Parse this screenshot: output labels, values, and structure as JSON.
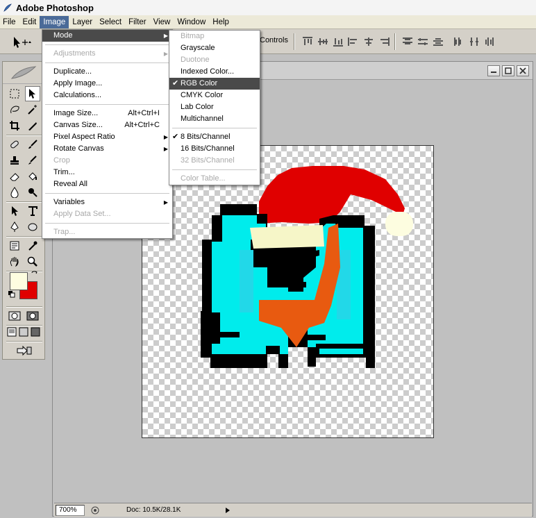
{
  "window": {
    "title": "Adobe Photoshop"
  },
  "menubar": [
    "File",
    "Edit",
    "Image",
    "Layer",
    "Select",
    "Filter",
    "View",
    "Window",
    "Help"
  ],
  "options_bar": {
    "controls_label": "Controls"
  },
  "image_menu": [
    {
      "label": "Mode",
      "submenu": true,
      "highlighted": true
    },
    {
      "sep": true
    },
    {
      "label": "Adjustments",
      "submenu": true,
      "disabled": true
    },
    {
      "sep": true
    },
    {
      "label": "Duplicate..."
    },
    {
      "label": "Apply Image..."
    },
    {
      "label": "Calculations..."
    },
    {
      "sep": true
    },
    {
      "label": "Image Size...",
      "shortcut": "Alt+Ctrl+I"
    },
    {
      "label": "Canvas Size...",
      "shortcut": "Alt+Ctrl+C"
    },
    {
      "label": "Pixel Aspect Ratio",
      "submenu": true
    },
    {
      "label": "Rotate Canvas",
      "submenu": true
    },
    {
      "label": "Crop",
      "disabled": true
    },
    {
      "label": "Trim..."
    },
    {
      "label": "Reveal All"
    },
    {
      "sep": true
    },
    {
      "label": "Variables",
      "submenu": true
    },
    {
      "label": "Apply Data Set...",
      "disabled": true
    },
    {
      "sep": true
    },
    {
      "label": "Trap...",
      "disabled": true
    }
  ],
  "mode_menu": [
    {
      "label": "Bitmap",
      "disabled": true
    },
    {
      "label": "Grayscale"
    },
    {
      "label": "Duotone",
      "disabled": true
    },
    {
      "label": "Indexed Color..."
    },
    {
      "label": "RGB Color",
      "checked": true,
      "highlighted": true
    },
    {
      "label": "CMYK Color"
    },
    {
      "label": "Lab Color"
    },
    {
      "label": "Multichannel"
    },
    {
      "sep": true
    },
    {
      "label": "8 Bits/Channel",
      "checked": true
    },
    {
      "label": "16 Bits/Channel"
    },
    {
      "label": "32 Bits/Channel",
      "disabled": true
    },
    {
      "sep": true
    },
    {
      "label": "Color Table...",
      "disabled": true
    }
  ],
  "status": {
    "zoom": "700%",
    "doc": "Doc: 10.5K/28.1K"
  },
  "colors": {
    "foreground": "#fdfde0",
    "background": "#e00000",
    "menu_highlight": "#4a4a4a"
  },
  "icons": [
    "photoshop-app-icon",
    "move-tool-icon",
    "marquee-tool-icon",
    "lasso-tool-icon",
    "magic-wand-icon",
    "crop-tool-icon",
    "slice-tool-icon",
    "healing-brush-icon",
    "brush-tool-icon",
    "clone-stamp-icon",
    "history-brush-icon",
    "eraser-tool-icon",
    "paint-bucket-icon",
    "blur-tool-icon",
    "dodge-tool-icon",
    "path-selection-icon",
    "type-tool-icon",
    "pen-tool-icon",
    "ellipse-tool-icon",
    "notes-tool-icon",
    "eyedropper-icon",
    "hand-tool-icon",
    "zoom-tool-icon",
    "swap-colors-icon",
    "default-colors-icon",
    "standard-mode-icon",
    "quickmask-mode-icon",
    "screen-mode-icons",
    "jump-to-imageready-icon"
  ]
}
